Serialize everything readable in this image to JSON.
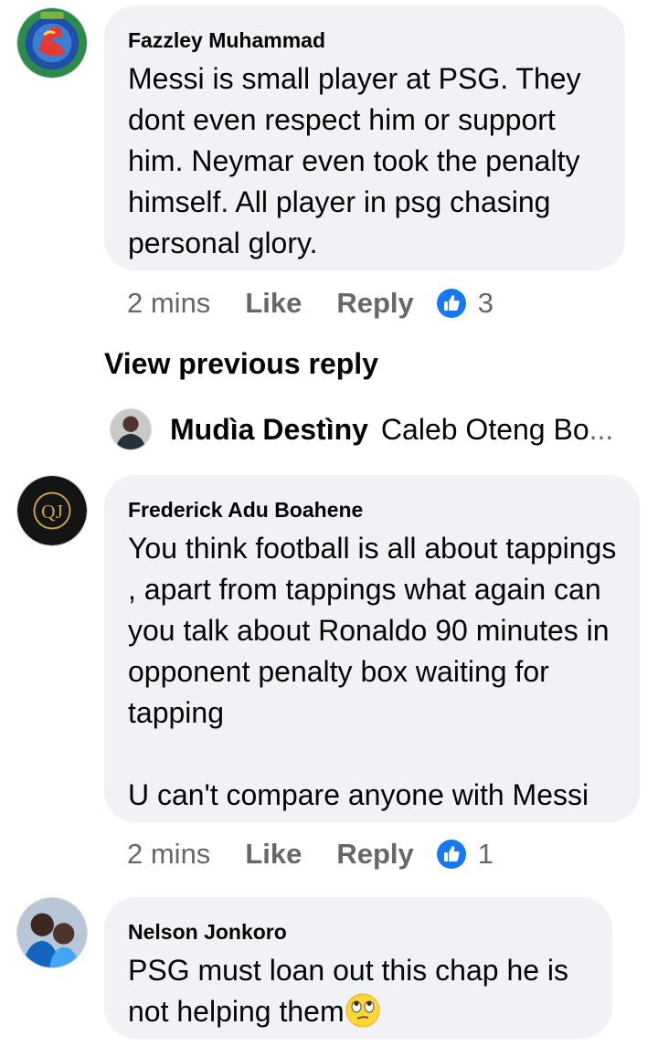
{
  "comments": [
    {
      "author": "Fazzley Muhammad",
      "text": "Messi is small player at PSG. They dont even respect him or support him. Neymar even took the penalty himself. All player in psg chasing personal glory.",
      "time": "2 mins",
      "like_label": "Like",
      "reply_label": "Reply",
      "reaction_count": "3",
      "avatar_icon": "colorful-logo-avatar"
    },
    {
      "author": "Frederick Adu Boahene",
      "text": "You think football is all about tappings , apart from tappings what again can you talk about Ronaldo 90 minutes in opponent penalty box waiting for tapping\n\nU can't compare anyone with Messi",
      "time": "2 mins",
      "like_label": "Like",
      "reply_label": "Reply",
      "reaction_count": "1",
      "avatar_icon": "gold-monogram-avatar",
      "monogram": "QJ"
    },
    {
      "author": "Nelson Jonkoro",
      "text": "PSG must loan out this chap he is not helping them",
      "emoji": "eye-roll-emoji",
      "avatar_icon": "photo-avatar"
    }
  ],
  "view_previous_reply": "View previous reply",
  "reply_preview": {
    "author": "Mudìa Destìny",
    "text": "Caleb Oteng Bo",
    "ellipsis": "..."
  },
  "colors": {
    "bubble": "#f0f2f5",
    "secondary_text": "#65676b",
    "like_blue": "#1877f2"
  }
}
